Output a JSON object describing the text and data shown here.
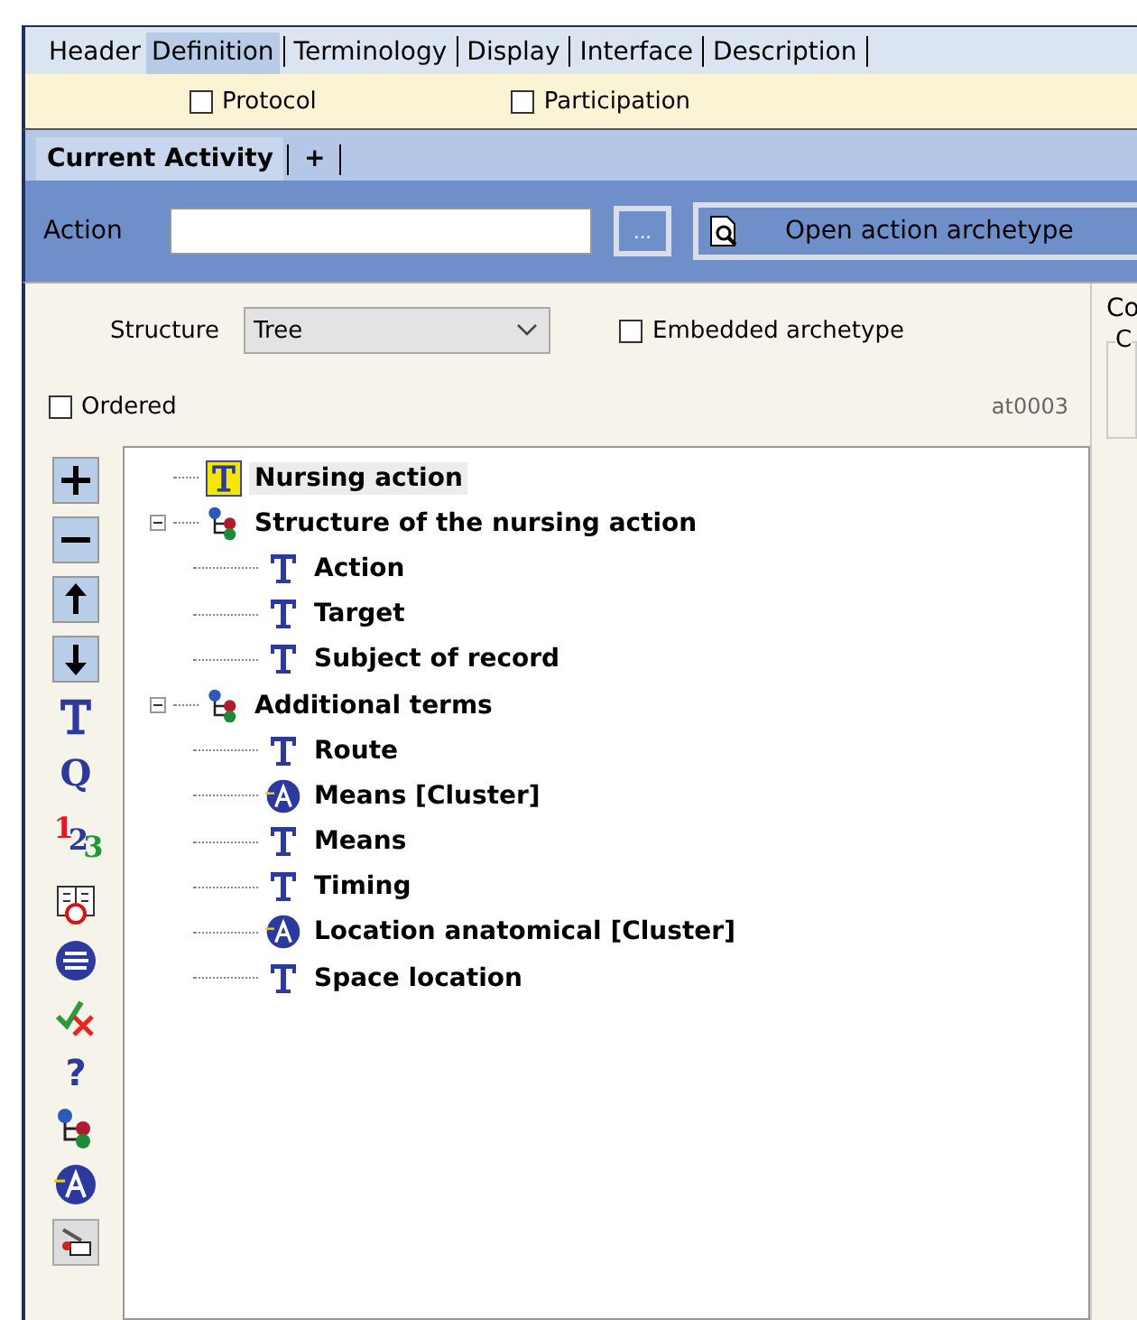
{
  "tabs": [
    {
      "label": "Header",
      "selected": false
    },
    {
      "label": "Definition",
      "selected": true
    },
    {
      "label": "Terminology",
      "selected": false
    },
    {
      "label": "Display",
      "selected": false
    },
    {
      "label": "Interface",
      "selected": false
    },
    {
      "label": "Description",
      "selected": false
    }
  ],
  "options": [
    {
      "label": "Protocol",
      "checked": false
    },
    {
      "label": "Participation",
      "checked": false
    }
  ],
  "activity_tabs": [
    {
      "label": "Current Activity",
      "selected": true
    },
    {
      "label": "+",
      "selected": false
    }
  ],
  "action": {
    "label": "Action",
    "browse": "...",
    "open_button": "Open action archetype"
  },
  "structure": {
    "label": "Structure",
    "value": "Tree",
    "embedded": {
      "label": "Embedded archetype",
      "checked": false
    }
  },
  "ordered": {
    "label": "Ordered",
    "checked": false
  },
  "code": "at0003",
  "toolbar": [
    {
      "kind": "plus"
    },
    {
      "kind": "minus"
    },
    {
      "kind": "up"
    },
    {
      "kind": "down"
    },
    {
      "kind": "text"
    },
    {
      "kind": "quantity",
      "glyph": "Q"
    },
    {
      "kind": "count",
      "glyph": "$^{1}$2$_{3}$"
    },
    {
      "kind": "datetime"
    },
    {
      "kind": "ordinal"
    },
    {
      "kind": "boolean"
    },
    {
      "kind": "any",
      "glyph": "?"
    },
    {
      "kind": "structure"
    },
    {
      "kind": "cluster"
    },
    {
      "kind": "slot"
    }
  ],
  "tree": [
    {
      "label": "Nursing action",
      "kind": "root",
      "selected": true
    },
    {
      "label": "Structure of the nursing action",
      "kind": "structure",
      "selected": false,
      "expanded": true,
      "children": [
        {
          "label": "Action",
          "kind": "text",
          "selected": false
        },
        {
          "label": "Target",
          "kind": "text",
          "selected": false
        },
        {
          "label": "Subject of record",
          "kind": "text",
          "selected": false
        }
      ]
    },
    {
      "label": "Additional terms",
      "kind": "structure",
      "selected": false,
      "expanded": true,
      "children": [
        {
          "label": "Route",
          "kind": "text",
          "selected": false
        },
        {
          "label": "Means [Cluster]",
          "kind": "cluster",
          "selected": false
        },
        {
          "label": "Means",
          "kind": "text",
          "selected": false
        },
        {
          "label": "Timing",
          "kind": "text",
          "selected": false
        },
        {
          "label": "Location anatomical [Cluster]",
          "kind": "cluster",
          "selected": false
        },
        {
          "label": "Space location",
          "kind": "text",
          "selected": false
        }
      ]
    }
  ],
  "side_panel": {
    "title": "Co",
    "group": "C"
  }
}
